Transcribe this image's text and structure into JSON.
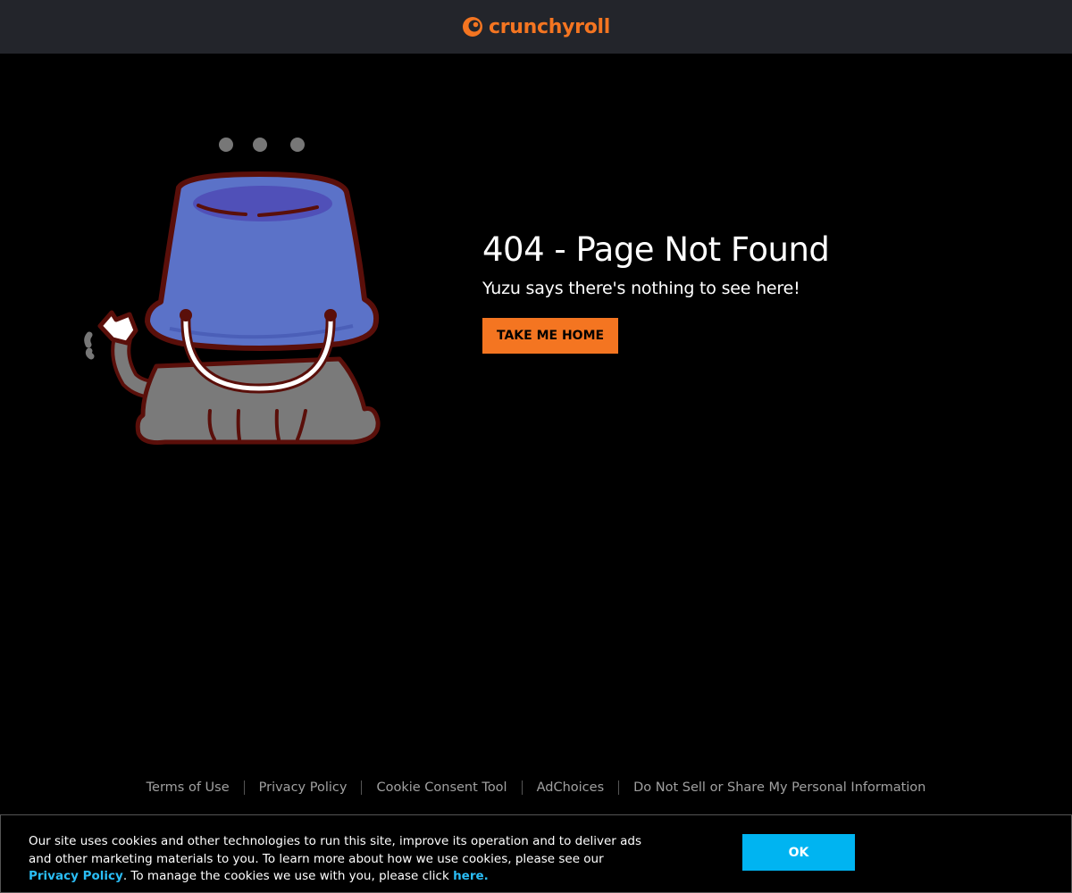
{
  "header": {
    "logo_text": "crunchyroll",
    "brand_color": "#f47521"
  },
  "main": {
    "title": "404 - Page Not Found",
    "subtitle": "Yuzu says there's nothing to see here!",
    "home_button_label": "TAKE ME HOME"
  },
  "footer": {
    "links": [
      "Terms of Use",
      "Privacy Policy",
      "Cookie Consent Tool",
      "AdChoices",
      "Do Not Sell or Share My Personal Information"
    ]
  },
  "cookie_banner": {
    "text_part1": "Our site uses cookies and other technologies to run this site, improve its operation and to deliver ads and other marketing materials to you.  To learn more about how we use cookies, please see our ",
    "privacy_link": "Privacy Policy",
    "text_part2": ". To manage the cookies we use with you, please click ",
    "here_link": "here.",
    "ok_label": "OK",
    "accent_color": "#00b4f1"
  }
}
